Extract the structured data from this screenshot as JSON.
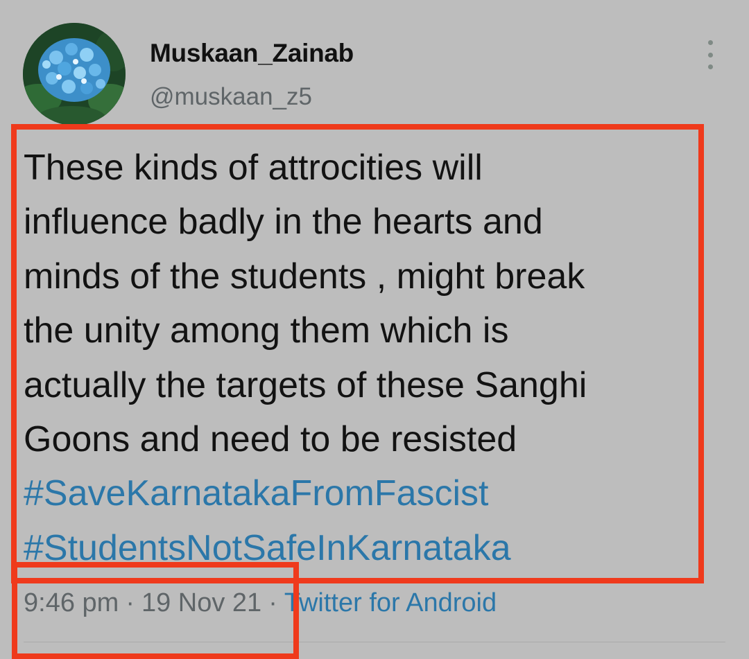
{
  "tweet": {
    "display_name": "Muskaan_Zainab",
    "handle": "@muskaan_z5",
    "avatar_icon": "hydrangea-flower-avatar",
    "text_lines": [
      "These kinds of attrocities will",
      "influence badly in the hearts and",
      "minds of the students , might break",
      "the unity among them which is",
      "actually the targets of these Sanghi",
      "Goons and need to be resisted"
    ],
    "hashtags": [
      "#SaveKarnatakaFromFascist",
      "#StudentsNotSafeInKarnataka"
    ],
    "time": "9:46 pm",
    "separator": "·",
    "date": "19 Nov 21",
    "source": "Twitter for Android"
  },
  "colors": {
    "background": "#bdbdbd",
    "link": "#2b77a9",
    "highlight_box": "#ef3a1c",
    "secondary_text": "#5f6568"
  }
}
